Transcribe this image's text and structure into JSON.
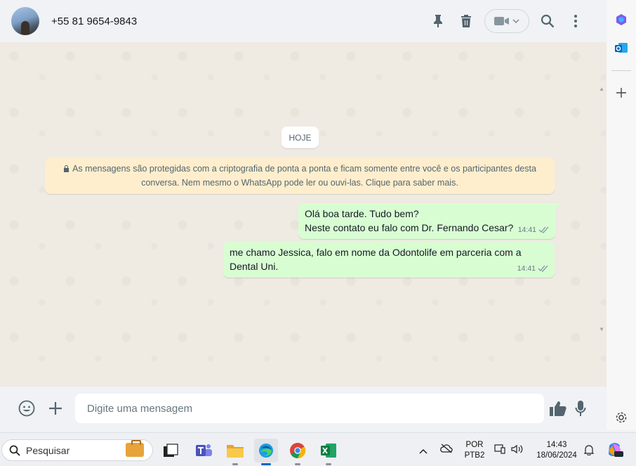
{
  "header": {
    "contact_name": "+55 81 9654-9843",
    "icons": [
      "pin-icon",
      "delete-icon",
      "video-call-icon",
      "search-icon",
      "menu-icon"
    ]
  },
  "chat": {
    "date_chip": "HOJE",
    "encryption_notice": "As mensagens são protegidas com a criptografia de ponta a ponta e ficam somente entre você e os participantes desta conversa. Nem mesmo o WhatsApp pode ler ou ouvi-las. Clique para saber mais.",
    "messages": [
      {
        "line1": "Olá boa tarde. Tudo bem?",
        "line2": "Neste contato eu falo com Dr. Fernando Cesar?",
        "time": "14:41",
        "status": "read"
      },
      {
        "line1": "me chamo Jessica, falo em nome da Odontolife em parceria com a",
        "line2": "Dental Uni.",
        "time": "14:41",
        "status": "read"
      }
    ]
  },
  "composer": {
    "placeholder": "Digite uma mensagem"
  },
  "taskbar": {
    "search_label": "Pesquisar",
    "lang_line1": "POR",
    "lang_line2": "PTB2",
    "time": "14:43",
    "date": "18/06/2024"
  },
  "colors": {
    "outgoing_bubble": "#d9fdd3",
    "notice_bg": "#ffeecd",
    "chat_bg": "#efeae2"
  }
}
